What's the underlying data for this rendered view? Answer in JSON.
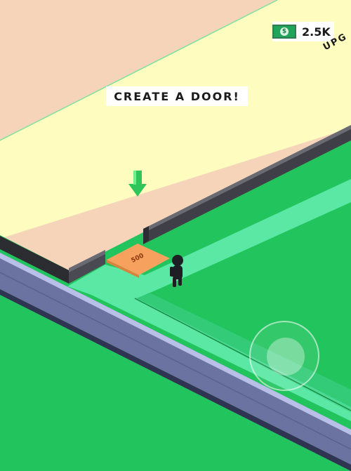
{
  "hud": {
    "money_amount": "2.5K",
    "objective_text": "CREATE A DOOR!",
    "upgrade_text": "UPG"
  },
  "world": {
    "door_pad_price": "500"
  },
  "icons": {
    "money": "money-bill-icon",
    "arrow": "arrow-down-icon"
  },
  "colors": {
    "floor": "#fffcc0",
    "outer_floor": "#f6d4b9",
    "grass": "#22c45e",
    "path": "#5ae8a4",
    "road": "#6b74a0",
    "wall": "#4a4a52",
    "pad": "#f6a25e",
    "arrow": "#2ec65a"
  }
}
